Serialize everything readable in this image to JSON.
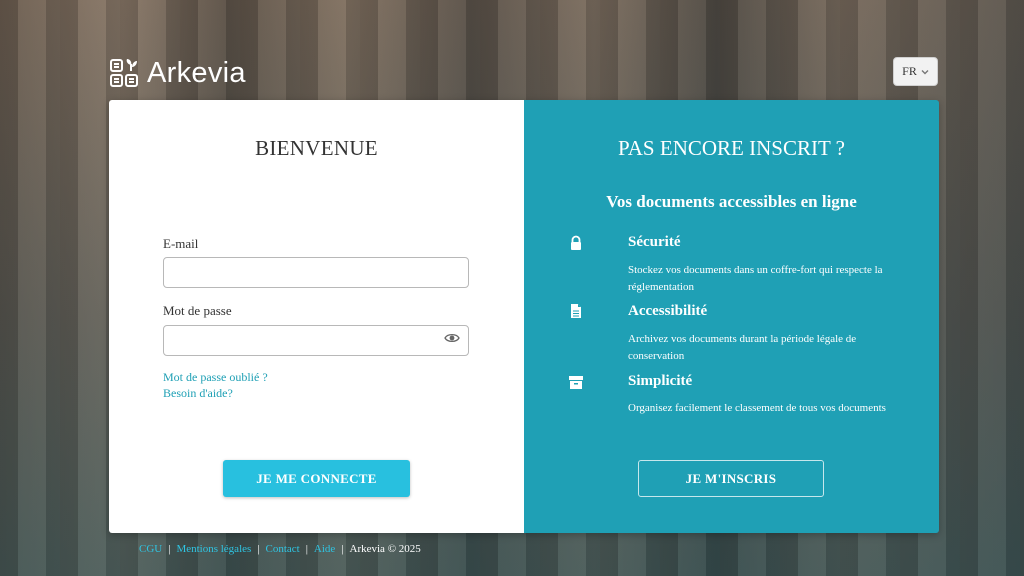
{
  "brand": {
    "name": "Arkevia"
  },
  "language": {
    "selected": "FR"
  },
  "login": {
    "title": "BIENVENUE",
    "email_label": "E-mail",
    "email_value": "",
    "password_label": "Mot de passe",
    "password_value": "",
    "forgot_link": "Mot de passe oublié ?",
    "help_link": "Besoin d'aide?",
    "submit_label": "JE ME CONNECTE"
  },
  "signup": {
    "title": "PAS ENCORE INSCRIT ?",
    "subtitle": "Vos documents accessibles en ligne",
    "features": [
      {
        "icon": "lock-icon",
        "title": "Sécurité",
        "description": "Stockez vos documents dans un coffre-fort qui respecte la réglementation"
      },
      {
        "icon": "document-icon",
        "title": "Accessibilité",
        "description": "Archivez vos documents durant la période légale de conservation"
      },
      {
        "icon": "archive-box-icon",
        "title": "Simplicité",
        "description": "Organisez facilement le classement de tous vos documents"
      }
    ],
    "submit_label": "JE M'INSCRIS"
  },
  "footer": {
    "links": [
      "CGU",
      "Mentions légales",
      "Contact",
      "Aide"
    ],
    "separator": "|",
    "copyright": "Arkevia © 2025"
  },
  "colors": {
    "accent": "#1fa0b5",
    "button": "#28c0df",
    "link": "#2fc4e2"
  }
}
